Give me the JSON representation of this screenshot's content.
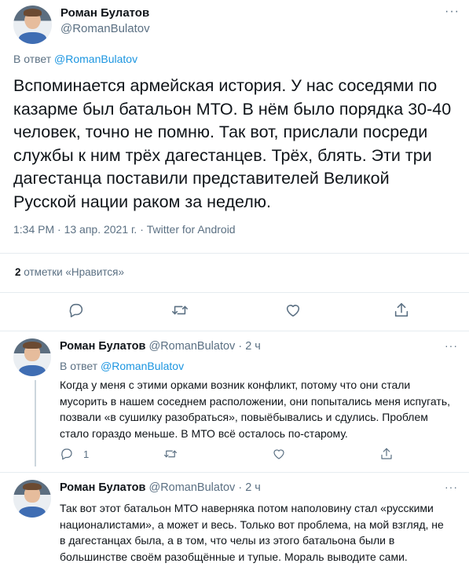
{
  "main_tweet": {
    "author_name": "Роман Булатов",
    "author_handle": "@RomanBulatov",
    "reply_prefix": "В ответ",
    "reply_to": "@RomanBulatov",
    "text": "Вспоминается армейская история. У нас соседями по казарме был батальон МТО. В нём было порядка 30-40 человек, точно не помню. Так вот, прислали посреди службы к ним трёх дагестанцев. Трёх, блять. Эти три дагестанца поставили представителей Великой Русской нации раком за неделю.",
    "time": "1:34 PM",
    "date": "13 апр. 2021 г.",
    "separator": "·",
    "source": "Twitter for Android",
    "likes_count": "2",
    "likes_label": "отметки «Нравится»",
    "more_icon": "···"
  },
  "replies": [
    {
      "author_name": "Роман Булатов",
      "author_handle": "@RomanBulatov",
      "age": "2 ч",
      "separator": "·",
      "reply_prefix": "В ответ",
      "reply_to": "@RomanBulatov",
      "text": "Когда у меня с этими орками возник конфликт, потому что они стали мусорить в нашем соседнем расположении, они попытались меня испугать, позвали «в сушилку разобраться», повыёбывались и сдулись. Проблем стало гораздо меньше. В МТО всё осталось по-старому.",
      "reply_count": "1",
      "more_icon": "···"
    },
    {
      "author_name": "Роман Булатов",
      "author_handle": "@RomanBulatov",
      "age": "2 ч",
      "separator": "·",
      "text": "Так вот этот батальон МТО наверняка потом наполовину стал «русскими националистами», а может и весь. Только вот проблема, на мой взгляд, не в дагестанцах была, а в том, что челы из этого батальона были в большинстве своём разобщённые и тупые. Мораль выводите сами.",
      "more_icon": "···"
    }
  ],
  "colors": {
    "text": "#0f1419",
    "muted": "#5b7083",
    "link": "#1b95e0",
    "divider": "#e6ecf0"
  }
}
